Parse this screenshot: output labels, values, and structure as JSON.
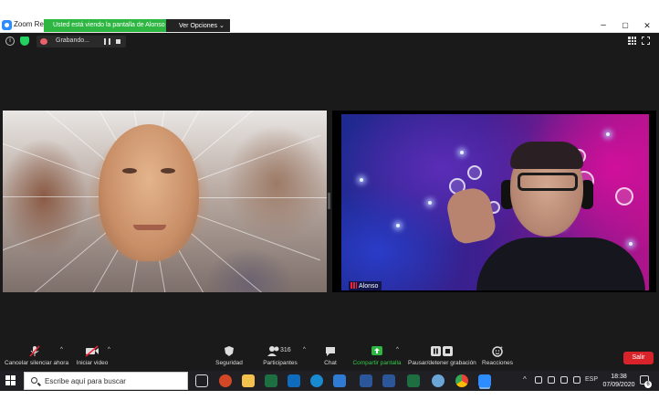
{
  "window": {
    "title": "Zoom Reuni",
    "minimize": "–",
    "maximize": "▢",
    "close": "✕"
  },
  "share_banner": {
    "text": "Usted está viendo la pantalla de Alonso",
    "view_options": "Ver Opciones"
  },
  "meeting": {
    "recording_label": "Grabando..."
  },
  "participant": {
    "name": "Alonso"
  },
  "toolbar": {
    "mute_label": "Cancelar silenciar ahora",
    "video_label": "Iniciar video",
    "security_label": "Seguridad",
    "participants_label": "Participantes",
    "participants_count": "316",
    "chat_label": "Chat",
    "share_label": "Compartir pantalla",
    "record_label": "Pausar/detener grabación",
    "reactions_label": "Reacciones",
    "leave_label": "Salir"
  },
  "taskbar": {
    "search_placeholder": "Escribe aquí para buscar",
    "language": "ESP",
    "time": "18:38",
    "date": "07/09/2020",
    "notifications": "6"
  },
  "colors": {
    "share_green": "#2db742",
    "leave_red": "#d9232b",
    "zoom_blue": "#2d8cff"
  },
  "icons": [
    "info-icon",
    "shield-icon",
    "record-icon",
    "pause-icon",
    "stop-icon",
    "gallery-grid-icon",
    "fullscreen-icon",
    "microphone-muted-icon",
    "video-off-icon",
    "security-shield-icon",
    "participants-icon",
    "chat-icon",
    "share-screen-icon",
    "record-controls-icon",
    "reactions-icon",
    "windows-start-icon",
    "search-icon"
  ]
}
